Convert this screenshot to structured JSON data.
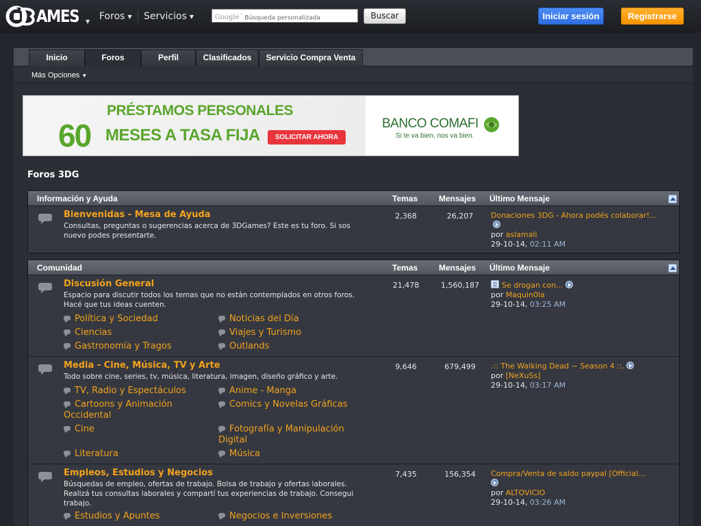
{
  "header": {
    "logo_text": "AMES",
    "nav_foros": "Foros",
    "nav_servicios": "Servicios",
    "search_brand": "Google",
    "search_brand_tm": "™",
    "search_placeholder": "Búsqueda personalizada",
    "search_button": "Buscar",
    "login_button": "Iniciar sesión",
    "register_button": "Registrarse"
  },
  "tabs": [
    {
      "label": "Inicio",
      "active": false
    },
    {
      "label": "Foros",
      "active": true
    },
    {
      "label": "Perfil",
      "active": false
    },
    {
      "label": "Clasificados",
      "active": false
    },
    {
      "label": "Servicio Compra Venta",
      "active": false
    }
  ],
  "subbar": {
    "more_options": "Más Opciones"
  },
  "ad": {
    "line1": "PRÉSTAMOS PERSONALES",
    "big_number": "60",
    "line2": "MESES A TASA FIJA",
    "cta": "SOLICITAR AHORA",
    "bank": "BANCO COMAFI",
    "tagline": "Si te va bien, nos va bien."
  },
  "forum_title": "Foros 3DG",
  "columns": {
    "temas": "Temas",
    "mensajes": "Mensajes",
    "ultimo": "Último Mensaje"
  },
  "categories": [
    {
      "name": "Información y Ayuda",
      "forums": [
        {
          "title": "Bienvenidas - Mesa de Ayuda",
          "description": "Consultas, preguntas o sugerencias acerca de 3DGames? Este es tu foro. Si sos nuevo podes presentarte.",
          "temas": "2,368",
          "mensajes": "26,207",
          "last_title": "Donaciones 3DG - Ahora podés colaborar!...",
          "last_by_prefix": "por",
          "last_user": "aslamali",
          "last_date": "29-10-14,",
          "last_time": "02:11 AM"
        }
      ]
    },
    {
      "name": "Comunidad",
      "forums": [
        {
          "title": "Discusión General",
          "description": "Espacio para discutir todos los temas que no están contemplados en otros foros. Hacé que tus ideas cuenten.",
          "temas": "21,478",
          "mensajes": "1,560,187",
          "last_title": "Se drogan con...",
          "last_by_prefix": "por",
          "last_user": "Maquin0la",
          "last_date": "29-10-14,",
          "last_time": "03:25 AM",
          "subforums": [
            "Política y Sociedad",
            "Noticias del Día",
            "Ciencias",
            "Viajes y Turismo",
            "Gastronomía y Tragos",
            "Outlands"
          ]
        },
        {
          "title": "Media - Cine, Música, TV y Arte",
          "description": "Todo sobre cine, series, tv, música, literatura, imagen, diseño gráfico y arte.",
          "temas": "9,646",
          "mensajes": "679,499",
          "last_title": ".:: The Walking Dead ~ Season 4 ::.",
          "last_by_prefix": "por",
          "last_user": "[NeXuSs]",
          "last_date": "29-10-14,",
          "last_time": "03:17 AM",
          "subforums": [
            "TV, Radio y Espectáculos",
            "Anime - Manga",
            "Cartoons y Animación Occidental",
            "Comics y Novelas Gráficas",
            "Cine",
            "Fotografía y Manipulación Digital",
            "Literatura",
            "Música"
          ]
        },
        {
          "title": "Empleos, Estudios y Negocios",
          "description": "Búsquedas de empleo, ofertas de trabajo. Bolsa de trabajo y ofertas laborales. Realizá tus consultas laborales y compartí tus experiencias de trabajo. Consegui trabajo.",
          "temas": "7,435",
          "mensajes": "156,354",
          "last_title": "Compra/Venta de saldo paypal [Official...",
          "last_by_prefix": "por",
          "last_user": "ALTOVICIO",
          "last_date": "29-10-14,",
          "last_time": "03:26 AM",
          "subforums": [
            "Estudios y Apuntes",
            "Negocios e Inversiones"
          ]
        }
      ]
    }
  ]
}
